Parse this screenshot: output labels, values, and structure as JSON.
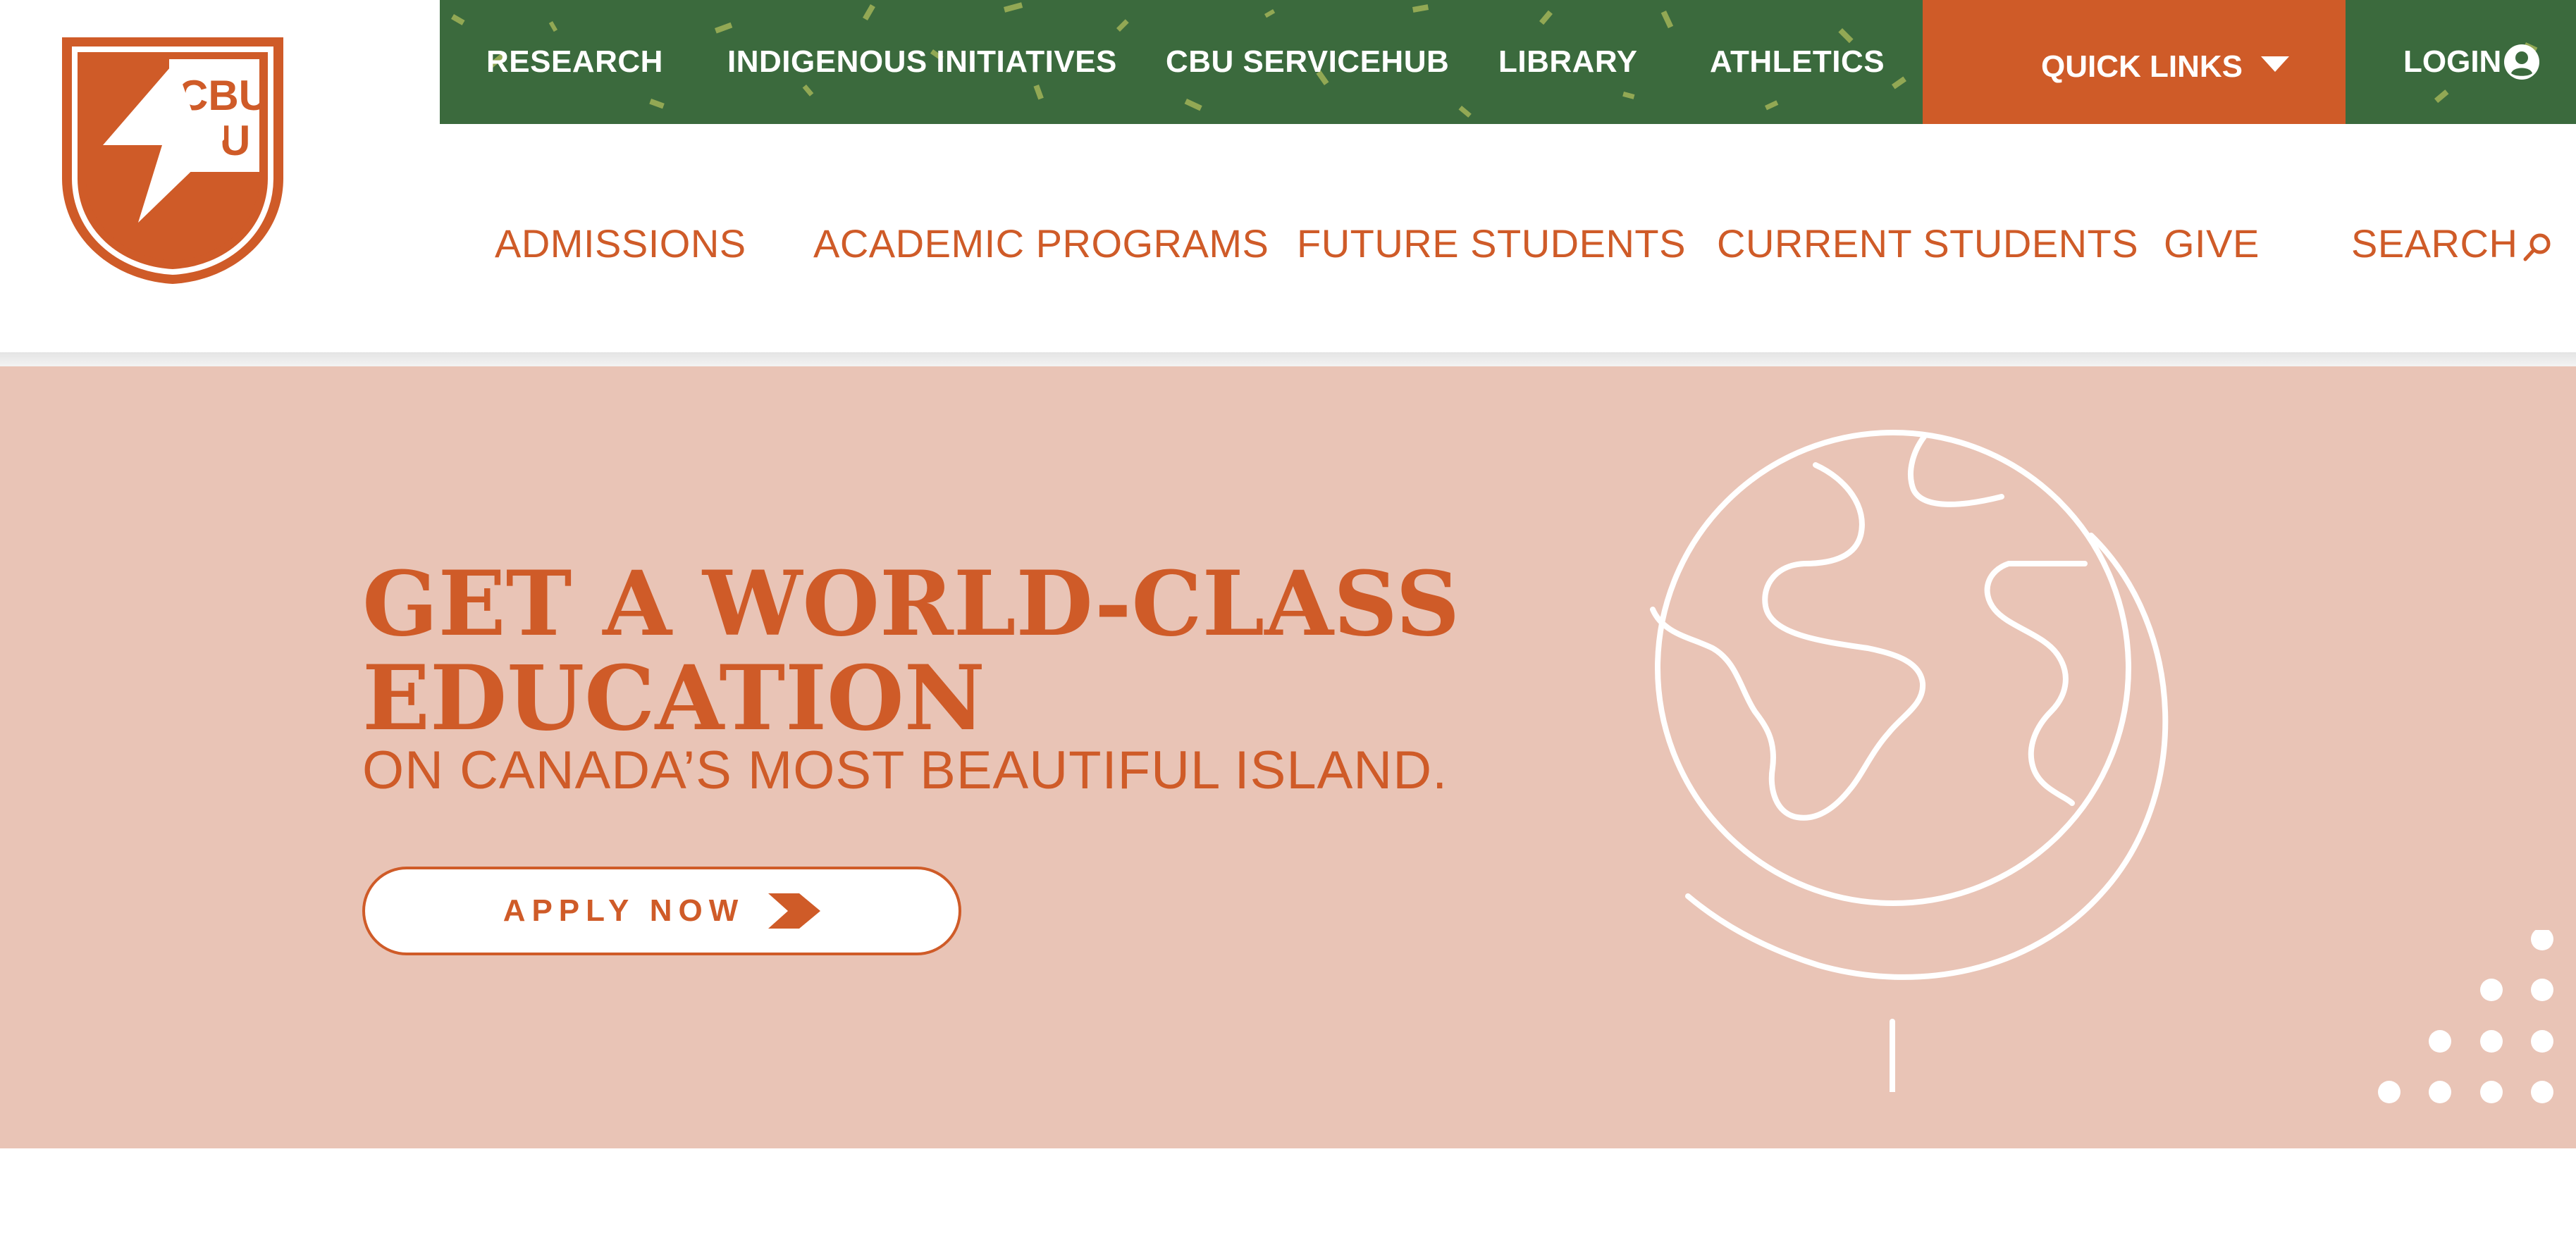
{
  "brand": {
    "logo_text": "CBU",
    "accent_color": "#cf5b28",
    "green_color": "#3b6a3d",
    "hero_bg": "#e9c4b6"
  },
  "topbar": {
    "items": [
      "RESEARCH",
      "INDIGENOUS INITIATIVES",
      "CBU SERVICEHUB",
      "LIBRARY",
      "ATHLETICS"
    ],
    "quick_links_label": "QUICK LINKS",
    "quick_links_icon": "caret-down-icon",
    "login_label": "LOGIN",
    "login_icon": "user-circle-icon"
  },
  "nav": {
    "items": [
      "ADMISSIONS",
      "ACADEMIC PROGRAMS",
      "FUTURE STUDENTS",
      "CURRENT STUDENTS",
      "GIVE"
    ],
    "search_label": "SEARCH",
    "search_icon": "search-icon"
  },
  "hero": {
    "headline_line1": "GET A WORLD-CLASS",
    "headline_line2": "EDUCATION",
    "subline": "ON CANADA’S MOST BEAUTIFUL ISLAND.",
    "cta_label": "APPLY NOW",
    "cta_icon": "chevron-arrow-icon",
    "illustration": "globe-icon"
  }
}
